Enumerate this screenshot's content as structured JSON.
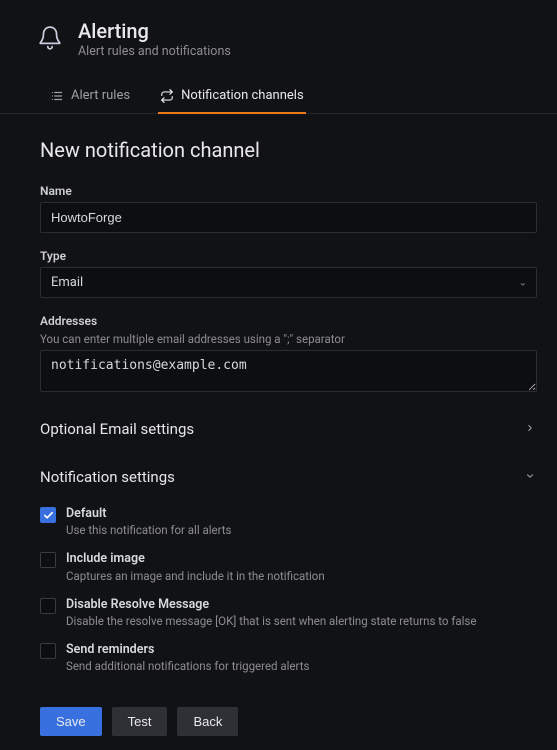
{
  "header": {
    "title": "Alerting",
    "subtitle": "Alert rules and notifications"
  },
  "tabs": {
    "alert_rules": "Alert rules",
    "notification_channels": "Notification channels"
  },
  "page": {
    "heading": "New notification channel"
  },
  "fields": {
    "name": {
      "label": "Name",
      "value": "HowtoForge"
    },
    "type": {
      "label": "Type",
      "value": "Email"
    },
    "addresses": {
      "label": "Addresses",
      "help": "You can enter multiple email addresses using a \";\" separator",
      "value": "notifications@example.com"
    }
  },
  "sections": {
    "optional_email": "Optional Email settings",
    "notification": "Notification settings"
  },
  "checks": {
    "default": {
      "label": "Default",
      "desc": "Use this notification for all alerts"
    },
    "image": {
      "label": "Include image",
      "desc": "Captures an image and include it in the notification"
    },
    "resolve": {
      "label": "Disable Resolve Message",
      "desc": "Disable the resolve message [OK] that is sent when alerting state returns to false"
    },
    "reminders": {
      "label": "Send reminders",
      "desc": "Send additional notifications for triggered alerts"
    }
  },
  "buttons": {
    "save": "Save",
    "test": "Test",
    "back": "Back"
  }
}
